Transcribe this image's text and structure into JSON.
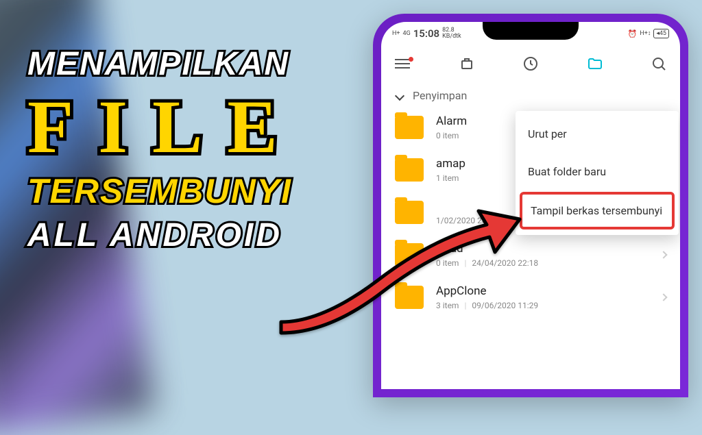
{
  "thumbnail": {
    "line1": "MENAMPILKAN",
    "line2": "FILE",
    "line3": "TERSEMBUNYI",
    "line4": "ALL ANDROID"
  },
  "statusbar": {
    "signal1": "H+",
    "signal2": "4G",
    "time": "15:08",
    "speed_val": "82.8",
    "speed_unit": "KB/dtk",
    "battery": "45"
  },
  "breadcrumb": {
    "path": "Penyimpan"
  },
  "files": [
    {
      "name": "Alarm",
      "items": "0 item",
      "date": ""
    },
    {
      "name": "amap",
      "items": "1 item",
      "date": ""
    },
    {
      "name": "",
      "items": "",
      "date": "1/02/2020 20:23"
    },
    {
      "name": "fraud",
      "items": "0 item",
      "date": "24/04/2020 22:18"
    },
    {
      "name": "AppClone",
      "items": "3 item",
      "date": "09/06/2020 11:29"
    }
  ],
  "menu": {
    "sort": "Urut per",
    "newfolder": "Buat folder baru",
    "showhidden": "Tampil berkas tersembunyi"
  }
}
